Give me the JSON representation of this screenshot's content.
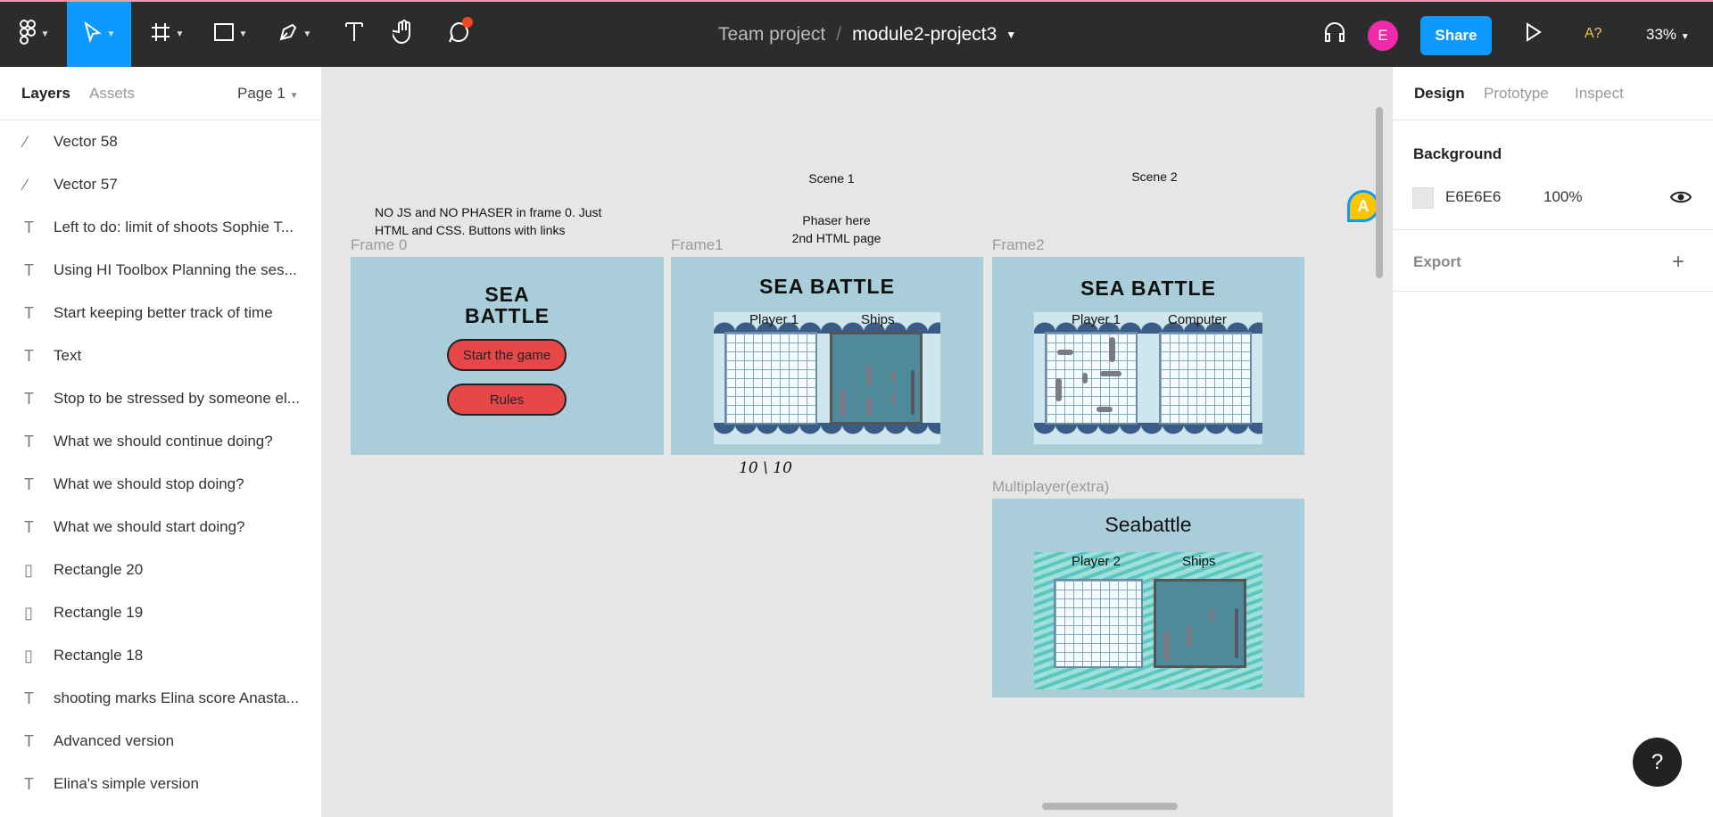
{
  "toolbar": {
    "project": "Team project",
    "separator": "/",
    "file_name": "module2-project3",
    "user_initial": "E",
    "share_label": "Share",
    "a11y_label": "A?",
    "zoom": "33%"
  },
  "left_panel": {
    "tabs": [
      "Layers",
      "Assets"
    ],
    "page": "Page 1",
    "layers": [
      {
        "name": "Vector 58",
        "icon": "vector-icon"
      },
      {
        "name": "Vector 57",
        "icon": "vector-icon"
      },
      {
        "name": "Left to do: limit of shoots Sophie T...",
        "icon": "text-icon"
      },
      {
        "name": "Using HI Toolbox Planning the ses...",
        "icon": "text-icon"
      },
      {
        "name": "Start keeping better track of time",
        "icon": "text-icon"
      },
      {
        "name": "Text",
        "icon": "text-icon"
      },
      {
        "name": "Stop to be stressed by someone el...",
        "icon": "text-icon"
      },
      {
        "name": "What we should continue doing?",
        "icon": "text-icon"
      },
      {
        "name": "What we should stop doing?",
        "icon": "text-icon"
      },
      {
        "name": "What we should start doing?",
        "icon": "text-icon"
      },
      {
        "name": "Rectangle 20",
        "icon": "rectangle-icon"
      },
      {
        "name": "Rectangle 19",
        "icon": "rectangle-icon"
      },
      {
        "name": "Rectangle 18",
        "icon": "rectangle-icon"
      },
      {
        "name": "shooting marks Elina score Anasta...",
        "icon": "text-icon"
      },
      {
        "name": "Advanced version",
        "icon": "text-icon"
      },
      {
        "name": "Elina's simple version",
        "icon": "text-icon"
      }
    ]
  },
  "right_panel": {
    "tabs": [
      "Design",
      "Prototype",
      "Inspect"
    ],
    "background_title": "Background",
    "background_hex": "E6E6E6",
    "background_opacity": "100%",
    "export_title": "Export",
    "background_color": "#e6e6e6"
  },
  "canvas": {
    "cursor_initial": "A",
    "notes": {
      "scene1": "Scene 1",
      "scene2": "Scene 2",
      "frame0_note_line1": "NO JS and NO PHASER in frame 0. Just",
      "frame0_note_line2": "HTML and CSS. Buttons with links",
      "phaser_line1": "Phaser here",
      "phaser_line2": "2nd HTML page",
      "handwritten": "10 \\ 10"
    },
    "frame0": {
      "label": "Frame 0",
      "title_line1": "SEA",
      "title_line2": "BATTLE",
      "start_button": "Start the game",
      "rules_button": "Rules"
    },
    "frame1": {
      "label": "Frame1",
      "title": "SEA BATTLE",
      "left_label": "Player 1",
      "right_label": "Ships"
    },
    "frame2": {
      "label": "Frame2",
      "title": "SEA BATTLE",
      "left_label": "Player 1",
      "right_label": "Computer"
    },
    "multiplayer": {
      "label": "Multiplayer(extra)",
      "title": "Seabattle",
      "left_label": "Player 2",
      "right_label": "Ships"
    }
  },
  "help_label": "?"
}
